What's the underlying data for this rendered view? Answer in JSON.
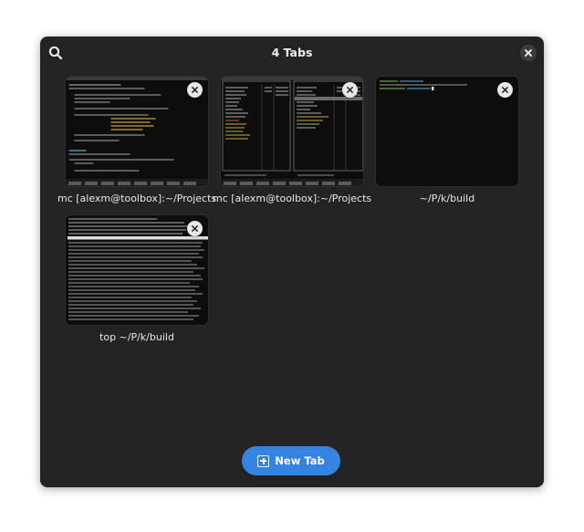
{
  "header": {
    "title": "4 Tabs",
    "search_icon": "search-icon",
    "close_icon": "close-icon"
  },
  "tabs": [
    {
      "title": "mc [alexm@toolbox]:~/Projects/",
      "preview": "code-editor"
    },
    {
      "title": "mc [alexm@toolbox]:~/Projects/",
      "preview": "midnight-commander"
    },
    {
      "title": "~/P/k/build",
      "preview": "shell-prompt"
    },
    {
      "title": "top ~/P/k/build",
      "preview": "top-process-list"
    }
  ],
  "new_tab": {
    "label": "New Tab",
    "icon": "new-tab-icon"
  },
  "colors": {
    "window_bg": "#232323",
    "accent": "#3584e4",
    "thumb_bg": "#0c0c0c"
  }
}
